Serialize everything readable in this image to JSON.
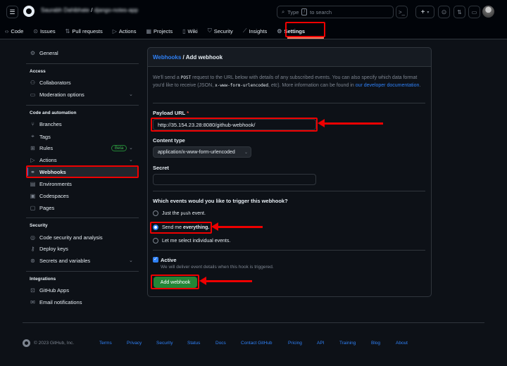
{
  "header": {
    "menu_icon": "hamburger-icon",
    "owner": "Saurabh Dahibhate",
    "separator": "/",
    "repo_name": "django-notes-app",
    "search_placeholder_pre": "Type",
    "search_key": "/",
    "search_placeholder_post": "to search",
    "command_icon": "terminal-icon",
    "plus_label": "+",
    "caret": "▾"
  },
  "tabs": [
    {
      "label": "Code",
      "icon": "code-icon"
    },
    {
      "label": "Issues",
      "icon": "issue-icon"
    },
    {
      "label": "Pull requests",
      "icon": "pull-request-icon"
    },
    {
      "label": "Actions",
      "icon": "play-icon"
    },
    {
      "label": "Projects",
      "icon": "table-icon"
    },
    {
      "label": "Wiki",
      "icon": "book-icon"
    },
    {
      "label": "Security",
      "icon": "shield-icon"
    },
    {
      "label": "Insights",
      "icon": "graph-icon"
    },
    {
      "label": "Settings",
      "icon": "gear-icon"
    }
  ],
  "sidebar": {
    "general": "General",
    "access_heading": "Access",
    "collaborators": "Collaborators",
    "moderation": "Moderation options",
    "code_heading": "Code and automation",
    "branches": "Branches",
    "tags": "Tags",
    "rules": "Rules",
    "beta": "Beta",
    "actions": "Actions",
    "webhooks": "Webhooks",
    "environments": "Environments",
    "codespaces": "Codespaces",
    "pages": "Pages",
    "security_heading": "Security",
    "code_security": "Code security and analysis",
    "deploy_keys": "Deploy keys",
    "secrets": "Secrets and variables",
    "integrations_heading": "Integrations",
    "github_apps": "GitHub Apps",
    "email_notifications": "Email notifications"
  },
  "main": {
    "breadcrumb_link": "Webhooks",
    "breadcrumb_sep": " / ",
    "breadcrumb_current": "Add webhook",
    "intro_1": "We'll send a ",
    "intro_code1": "POST",
    "intro_2": " request to the URL below with details of any subscribed events. You can also specify which data format you'd like to receive (JSON, ",
    "intro_code2": "x-www-form-urlencoded",
    "intro_3": ", ",
    "intro_etc": "etc",
    "intro_4": "). More information can be found in ",
    "intro_link": "our developer documentation",
    "intro_5": ".",
    "payload_label": "Payload URL",
    "required_mark": "*",
    "payload_value": "http://35.154.23.28:8080/github-webhook/",
    "content_type_label": "Content type",
    "content_type_value": "application/x-www-form-urlencoded",
    "secret_label": "Secret",
    "secret_value": "",
    "events_question": "Which events would you like to trigger this webhook?",
    "option1_pre": "Just the ",
    "option1_code": "push",
    "option1_post": " event.",
    "option2_pre": "Send me ",
    "option2_bold": "everything.",
    "option3": "Let me select individual events.",
    "active_label": "Active",
    "active_desc": "We will deliver event details when this hook is triggered.",
    "submit": "Add webhook"
  },
  "footer": {
    "copyright": "© 2023 GitHub, Inc.",
    "links": [
      "Terms",
      "Privacy",
      "Security",
      "Status",
      "Docs",
      "Contact GitHub",
      "Pricing",
      "API",
      "Training",
      "Blog",
      "About"
    ]
  },
  "colors": {
    "annotation": "#e00000",
    "accent": "#2f81f7",
    "primary_button": "#238636"
  }
}
